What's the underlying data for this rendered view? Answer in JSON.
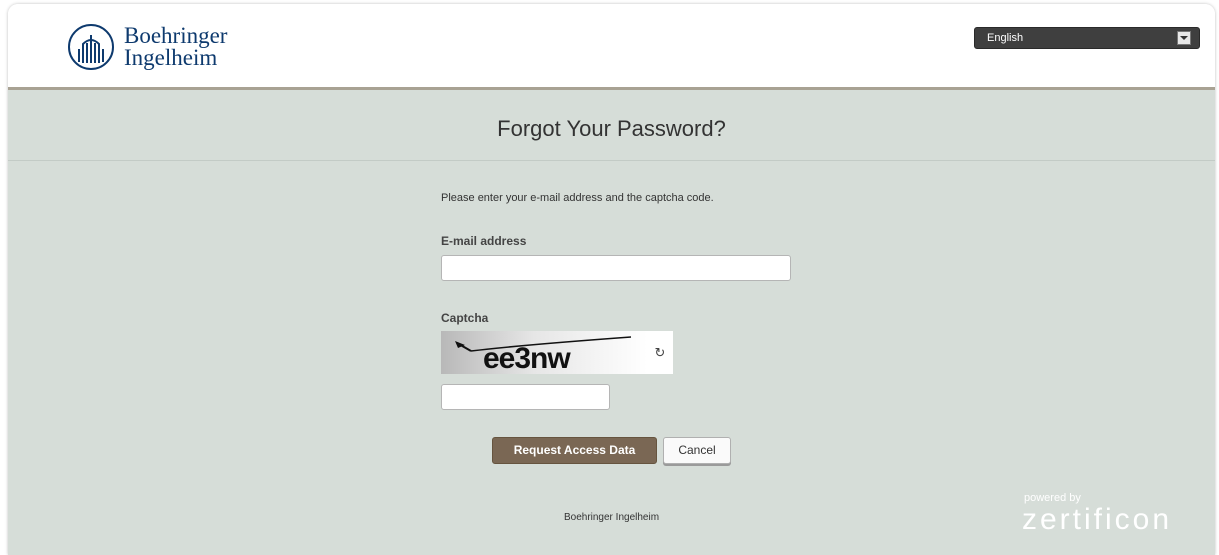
{
  "header": {
    "logo_line1": "Boehringer",
    "logo_line2": "Ingelheim",
    "language": "English"
  },
  "page": {
    "title": "Forgot Your Password?",
    "instructions": "Please enter your e-mail address and the captcha code."
  },
  "form": {
    "email_label": "E-mail address",
    "email_value": "",
    "captcha_label": "Captcha",
    "captcha_text": "ee3nw",
    "captcha_value": "",
    "submit_label": "Request Access Data",
    "cancel_label": "Cancel"
  },
  "footer": {
    "company": "Boehringer Ingelheim",
    "powered_by": "powered by",
    "brand": "zertificon"
  },
  "colors": {
    "brand_blue": "#0e3a6e",
    "panel_bg": "#d6ddd8",
    "primary_button": "#7a6754"
  },
  "icons": {
    "logo": "boehringer-logo-icon",
    "language_dropdown": "chevron-down-icon",
    "captcha_refresh": "refresh-icon"
  }
}
